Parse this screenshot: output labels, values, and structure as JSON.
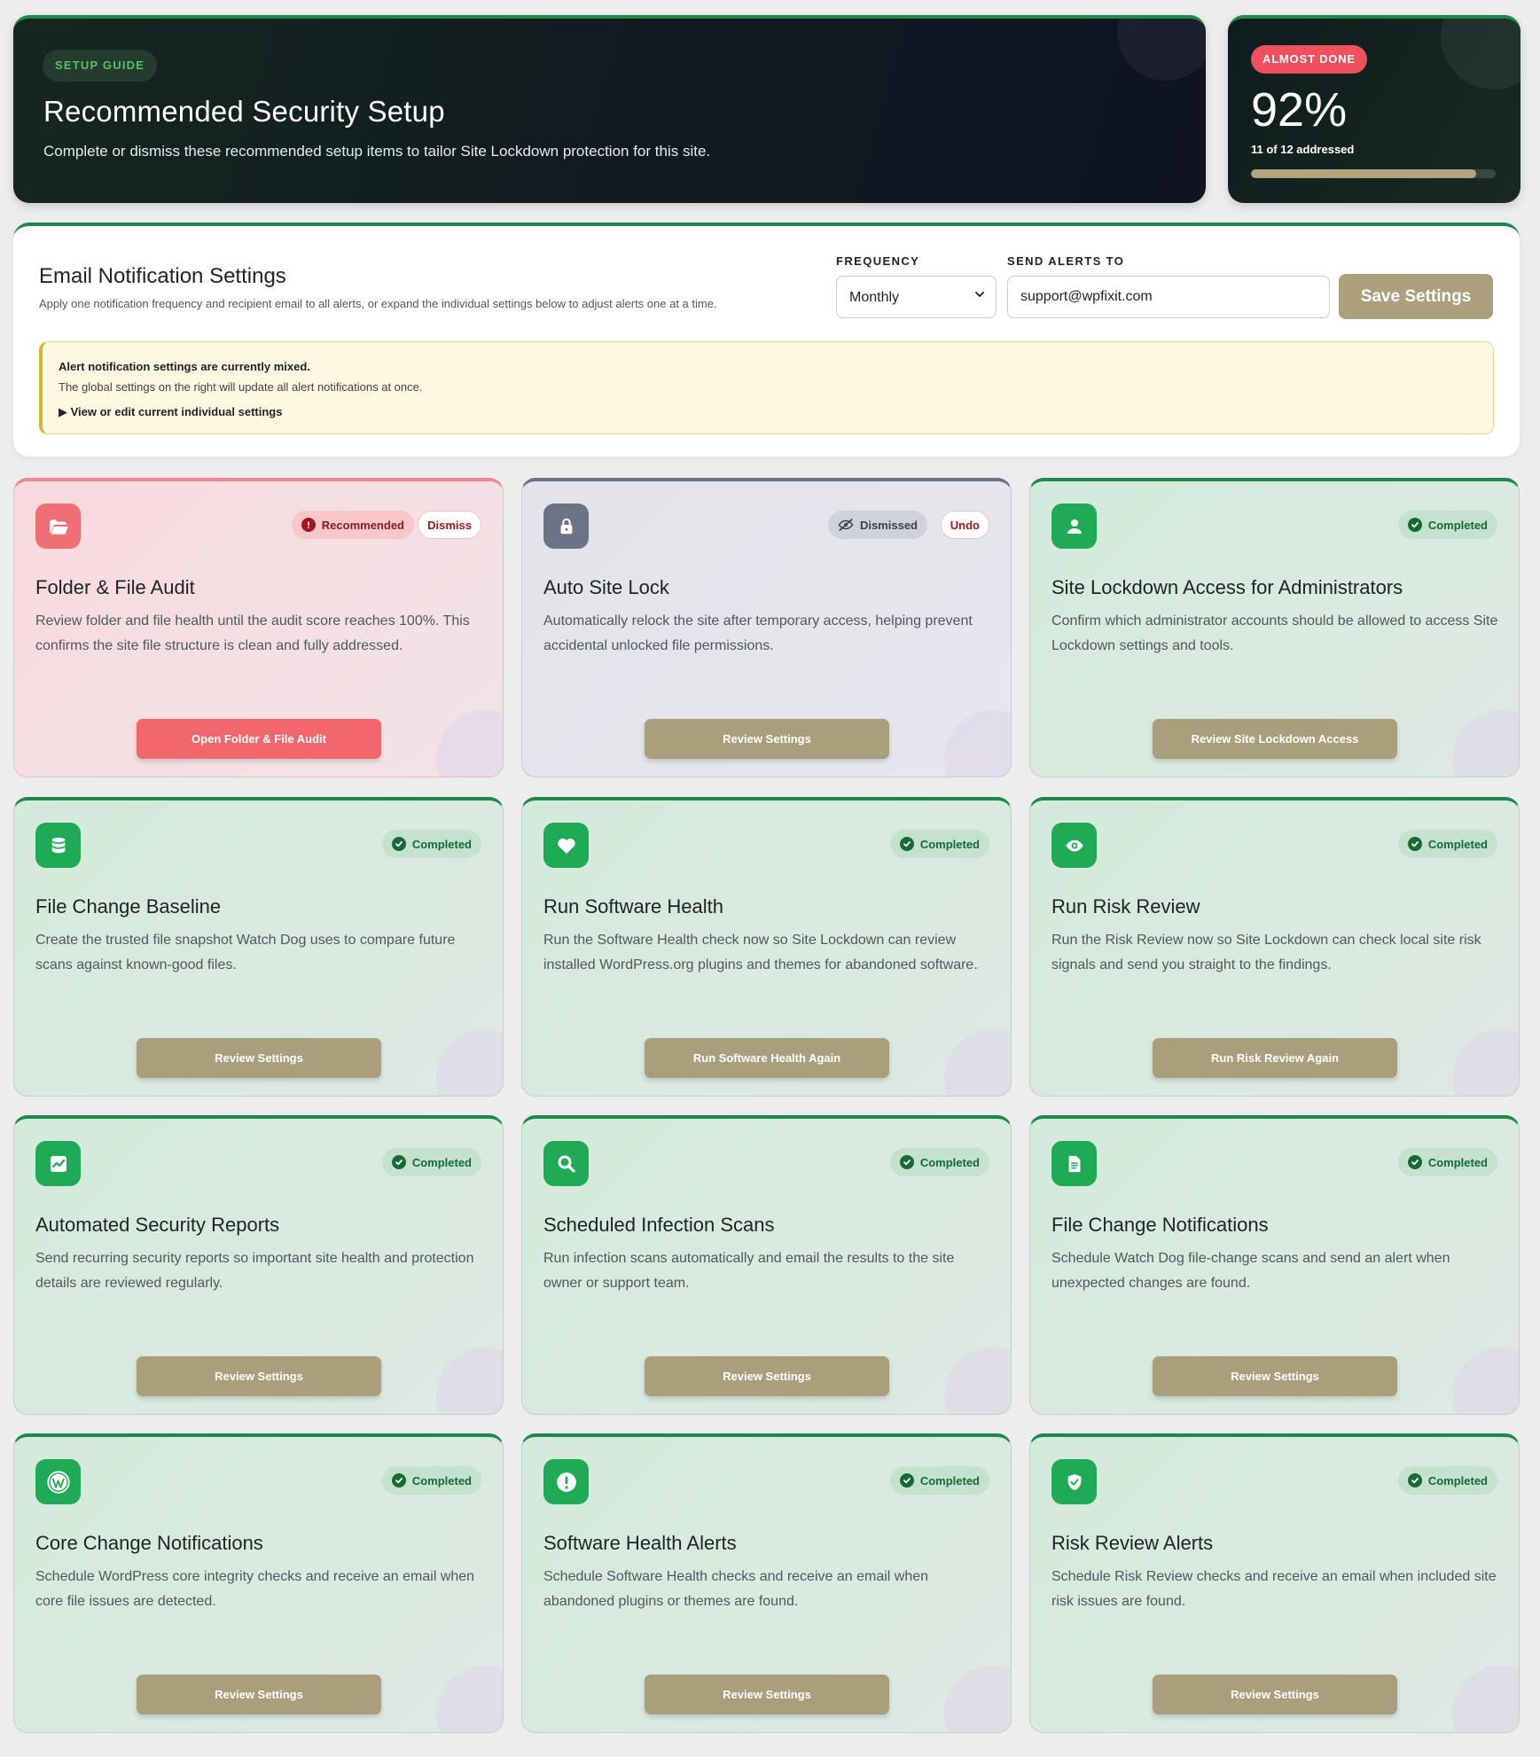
{
  "hero": {
    "tag": "SETUP GUIDE",
    "title": "Recommended Security Setup",
    "subtitle": "Complete or dismiss these recommended setup items to tailor Site Lockdown protection for this site."
  },
  "progress": {
    "badge": "ALMOST DONE",
    "percent_label": "92%",
    "summary": "11 of 12 addressed",
    "fill_fraction": 0.92
  },
  "email_settings": {
    "title": "Email Notification Settings",
    "description": "Apply one notification frequency and recipient email to all alerts, or expand the individual settings below to adjust alerts one at a time.",
    "frequency_label": "FREQUENCY",
    "frequency_value": "Monthly",
    "send_to_label": "SEND ALERTS TO",
    "send_to_value": "support@wpfixit.com",
    "save_label": "Save Settings",
    "notice": {
      "line1": "Alert notification settings are currently mixed.",
      "line2": "The global settings on the right will update all alert notifications at once.",
      "toggle": "▶ View or edit current individual settings"
    }
  },
  "labels": {
    "recommended": "Recommended",
    "dismiss": "Dismiss",
    "dismissed": "Dismissed",
    "undo": "Undo",
    "completed": "Completed"
  },
  "colors": {
    "accent_green": "#1d8a4a",
    "recommended_red": "#f06f74",
    "dismissed_slate": "#6b7486",
    "button_tan": "#a99f7d"
  },
  "cards": [
    {
      "status": "recommended",
      "icon": "folder-open-icon",
      "title": "Folder & File Audit",
      "description": "Review folder and file health until the audit score reaches 100%. This confirms the site file structure is clean and fully addressed.",
      "button": "Open Folder & File Audit"
    },
    {
      "status": "dismissed",
      "icon": "lock-icon",
      "title": "Auto Site Lock",
      "description": "Automatically relock the site after temporary access, helping prevent accidental unlocked file permissions.",
      "button": "Review Settings"
    },
    {
      "status": "completed",
      "icon": "user-icon",
      "title": "Site Lockdown Access for Administrators",
      "description": "Confirm which administrator accounts should be allowed to access Site Lockdown settings and tools.",
      "button": "Review Site Lockdown Access"
    },
    {
      "status": "completed",
      "icon": "database-icon",
      "title": "File Change Baseline",
      "description": "Create the trusted file snapshot Watch Dog uses to compare future scans against known-good files.",
      "button": "Review Settings"
    },
    {
      "status": "completed",
      "icon": "heart-icon",
      "title": "Run Software Health",
      "description": "Run the Software Health check now so Site Lockdown can review installed WordPress.org plugins and themes for abandoned software.",
      "button": "Run Software Health Again"
    },
    {
      "status": "completed",
      "icon": "eye-icon",
      "title": "Run Risk Review",
      "description": "Run the Risk Review now so Site Lockdown can check local site risk signals and send you straight to the findings.",
      "button": "Run Risk Review Again"
    },
    {
      "status": "completed",
      "icon": "report-icon",
      "title": "Automated Security Reports",
      "description": "Send recurring security reports so important site health and protection details are reviewed regularly.",
      "button": "Review Settings"
    },
    {
      "status": "completed",
      "icon": "search-icon",
      "title": "Scheduled Infection Scans",
      "description": "Run infection scans automatically and email the results to the site owner or support team.",
      "button": "Review Settings"
    },
    {
      "status": "completed",
      "icon": "document-icon",
      "title": "File Change Notifications",
      "description": "Schedule Watch Dog file-change scans and send an alert when unexpected changes are found.",
      "button": "Review Settings"
    },
    {
      "status": "completed",
      "icon": "wordpress-icon",
      "title": "Core Change Notifications",
      "description": "Schedule WordPress core integrity checks and receive an email when core file issues are detected.",
      "button": "Review Settings"
    },
    {
      "status": "completed",
      "icon": "alert-icon",
      "title": "Software Health Alerts",
      "description": "Schedule Software Health checks and receive an email when abandoned plugins or themes are found.",
      "button": "Review Settings"
    },
    {
      "status": "completed",
      "icon": "shield-icon",
      "title": "Risk Review Alerts",
      "description": "Schedule Risk Review checks and receive an email when included site risk issues are found.",
      "button": "Review Settings"
    }
  ]
}
